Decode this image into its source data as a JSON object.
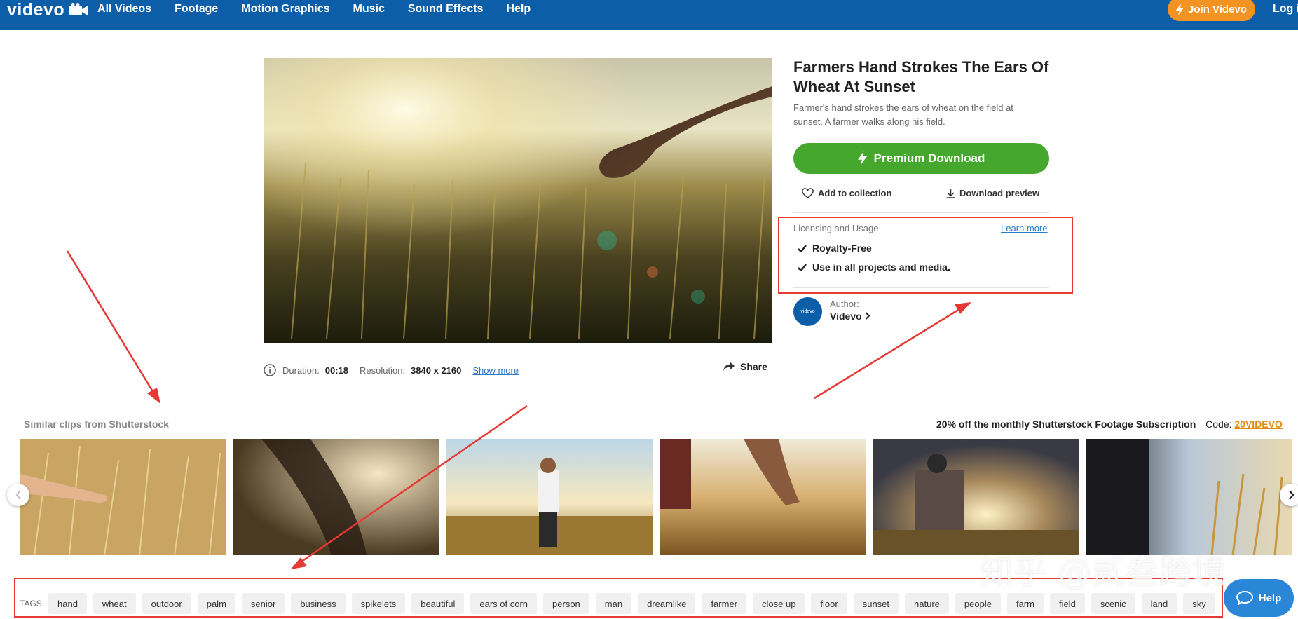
{
  "nav": {
    "logo": "videvo",
    "links": [
      "All Videos",
      "Footage",
      "Motion Graphics",
      "Music",
      "Sound Effects",
      "Help"
    ],
    "join_label": "Join Videvo",
    "login_label": "Log in"
  },
  "video": {
    "duration_label": "Duration:",
    "duration": "00:18",
    "resolution_label": "Resolution:",
    "resolution": "3840 x 2160",
    "show_more": "Show more",
    "share_label": "Share"
  },
  "details": {
    "title": "Farmers Hand Strokes The Ears Of Wheat At Sunset",
    "description": "Farmer's hand strokes the ears of wheat on the field at sunset. A farmer walks along his field.",
    "premium_label": "Premium Download",
    "add_collection": "Add to collection",
    "download_preview": "Download preview"
  },
  "licensing": {
    "heading": "Licensing and Usage",
    "learn_more": "Learn more",
    "items": [
      "Royalty-Free",
      "Use in all projects and media."
    ]
  },
  "author": {
    "label": "Author:",
    "name": "Videvo",
    "avatar_text": "videvo"
  },
  "similar": {
    "heading": "Similar clips from Shutterstock",
    "promo": "20% off the monthly Shutterstock Footage Subscription",
    "code_label": "Code:",
    "code": "20VIDEVO"
  },
  "tags": {
    "label": "TAGS",
    "items": [
      "hand",
      "wheat",
      "outdoor",
      "palm",
      "senior",
      "business",
      "spikelets",
      "beautiful",
      "ears of corn",
      "person",
      "man",
      "dreamlike",
      "farmer",
      "close up",
      "floor",
      "sunset",
      "nature",
      "people",
      "farm",
      "field",
      "scenic",
      "land",
      "sky"
    ]
  },
  "help_label": "Help",
  "watermark": "知乎 @贰叁跨境",
  "colors": {
    "nav_bg": "#0d5ea8",
    "join": "#f39322",
    "premium": "#46a72f",
    "annotation": "#e53935",
    "link": "#2a7ac9",
    "code": "#e38a12"
  }
}
